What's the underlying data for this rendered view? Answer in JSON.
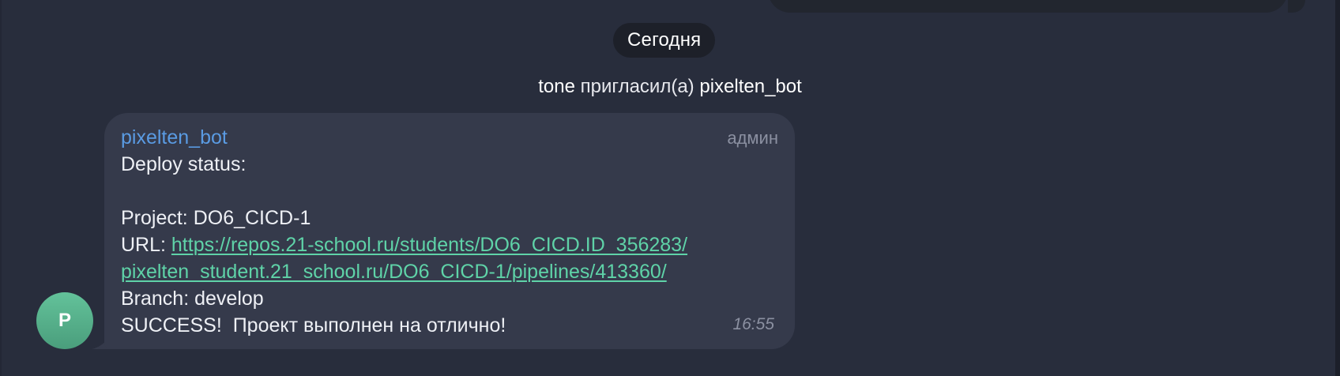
{
  "date_separator": "Сегодня",
  "service_message": {
    "inviter": "tone",
    "action": " пригласил(а) ",
    "invitee": "pixelten_bot"
  },
  "message": {
    "sender": "pixelten_bot",
    "badge": "админ",
    "lines": {
      "status_title": "Deploy status:",
      "project": "Project: DO6_CICD-1",
      "url_prefix": "URL: ",
      "url_line1": "https://repos.21-school.ru/students/DO6_CICD.ID_356283/",
      "url_line2": "pixelten_student.21_school.ru/DO6_CICD-1/pipelines/413360/",
      "branch": "Branch: develop",
      "result": "SUCCESS!  Проект выполнен на отлично!"
    },
    "time": "16:55"
  },
  "avatar": {
    "letter": "P",
    "color": "#57b08b"
  },
  "colors": {
    "background": "#282d3c",
    "bubble": "#353a4b",
    "sender_name": "#5a9be3",
    "link": "#5fd3a8"
  }
}
